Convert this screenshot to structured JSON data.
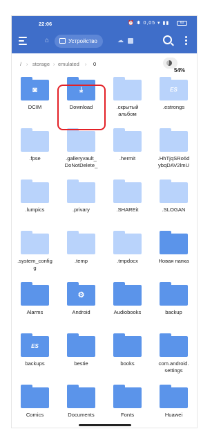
{
  "status_bar": {
    "time": "22:06",
    "icons_text": "⏰ ✱ 0,05 ▾ ▮▮ ",
    "battery": "60"
  },
  "app_bar": {
    "location_chip": "Устройство"
  },
  "breadcrumb": {
    "root": "/",
    "storage": "storage",
    "emulated": "emulated",
    "current": "0",
    "usage": "54%"
  },
  "colors": {
    "app_bar": "#3f6ec9",
    "folder_light": "#b9d3fb",
    "folder_dark": "#5b94ea",
    "highlight": "#e32026"
  },
  "folders": [
    {
      "label": "DCIM",
      "style": "dark",
      "icon": "camera-icon"
    },
    {
      "label": "Download",
      "style": "dark",
      "icon": "download-icon",
      "highlighted": true
    },
    {
      "label": ".скрытый\nальбом",
      "style": "light",
      "icon": ""
    },
    {
      "label": ".estrongs",
      "style": "light",
      "icon": "es-logo-icon"
    },
    {
      "label": ".fpse",
      "style": "light",
      "icon": ""
    },
    {
      "label": ".galleryvault_\nDoNotDelete_",
      "style": "light",
      "icon": ""
    },
    {
      "label": ".hermit",
      "style": "light",
      "icon": ""
    },
    {
      "label": ".HhTjqSRo6d\nybqDAV2lmU",
      "style": "light",
      "icon": ""
    },
    {
      "label": ".lumpics",
      "style": "light",
      "icon": ""
    },
    {
      "label": ".privary",
      "style": "light",
      "icon": ""
    },
    {
      "label": ".SHAREit",
      "style": "light",
      "icon": ""
    },
    {
      "label": ".SLOGAN",
      "style": "light",
      "icon": ""
    },
    {
      "label": ".system_config\ng",
      "style": "light",
      "icon": ""
    },
    {
      "label": ".temp",
      "style": "light",
      "icon": ""
    },
    {
      "label": ".tmpdocx",
      "style": "light",
      "icon": ""
    },
    {
      "label": "Новая папка",
      "style": "dark",
      "icon": ""
    },
    {
      "label": "Alarms",
      "style": "dark",
      "icon": ""
    },
    {
      "label": "Android",
      "style": "dark",
      "icon": "gear-icon"
    },
    {
      "label": "Audiobooks",
      "style": "dark",
      "icon": ""
    },
    {
      "label": "backup",
      "style": "dark",
      "icon": ""
    },
    {
      "label": "backups",
      "style": "dark",
      "icon": "es-logo-icon"
    },
    {
      "label": "bestie",
      "style": "dark",
      "icon": ""
    },
    {
      "label": "books",
      "style": "dark",
      "icon": ""
    },
    {
      "label": "com.android.\nsettings",
      "style": "dark",
      "icon": ""
    },
    {
      "label": "Comics",
      "style": "dark",
      "icon": ""
    },
    {
      "label": "Documents",
      "style": "dark",
      "icon": ""
    },
    {
      "label": "Fonts",
      "style": "dark",
      "icon": ""
    },
    {
      "label": "Huawei",
      "style": "dark",
      "icon": ""
    }
  ]
}
